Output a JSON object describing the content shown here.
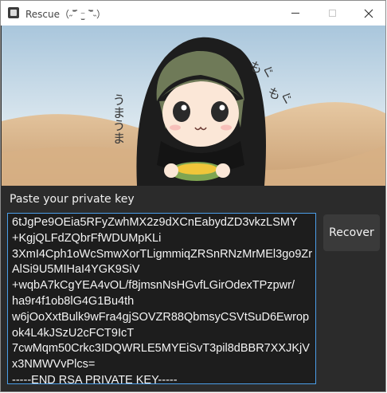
{
  "window": {
    "title": "Rescue（˶‾᷄ ⁻̫ ‾᷅˵）"
  },
  "content": {
    "prompt_label": "Paste your private key",
    "key_text": "6tJgPe9OEia5RFyZwhMX2z9dXCnEabydZD3vkzLSMY\n+KgjQLFdZQbrFfWDUMpKLi\n3XmI4Cph1oWcSmwXorTLigmmiqZRSnRNzMrMEl3go9ZrAlSi9U5MIHaI4YGK9SiV\n+wqbA7kCgYEA4vOL/f8jmsnNsHGvfLGirOdexTPzpwr/\nha9r4f1ob8lG4G1Bu4th\nw6jOoXxtBulk9wFra4gjSOVZR88QbmsyCSVtSuD6Ewropok4L4kJSzU2cFCT9IcT\n7cwMqm50Crkc3IDQWRLE5MYEiSvT3pil8dBBR7XXJKjVx3NMWVvPlcs=\n-----END RSA PRIVATE KEY-----",
    "recover_label": "Recover"
  },
  "hero_image": {
    "description_text": [
      "もぐ",
      "もぐ",
      "うまうま"
    ]
  },
  "colors": {
    "background": "#2b2b2b",
    "accent_border": "#4b9ee8",
    "sky": "#c7d8e4",
    "sand": "#e7c9a4"
  }
}
